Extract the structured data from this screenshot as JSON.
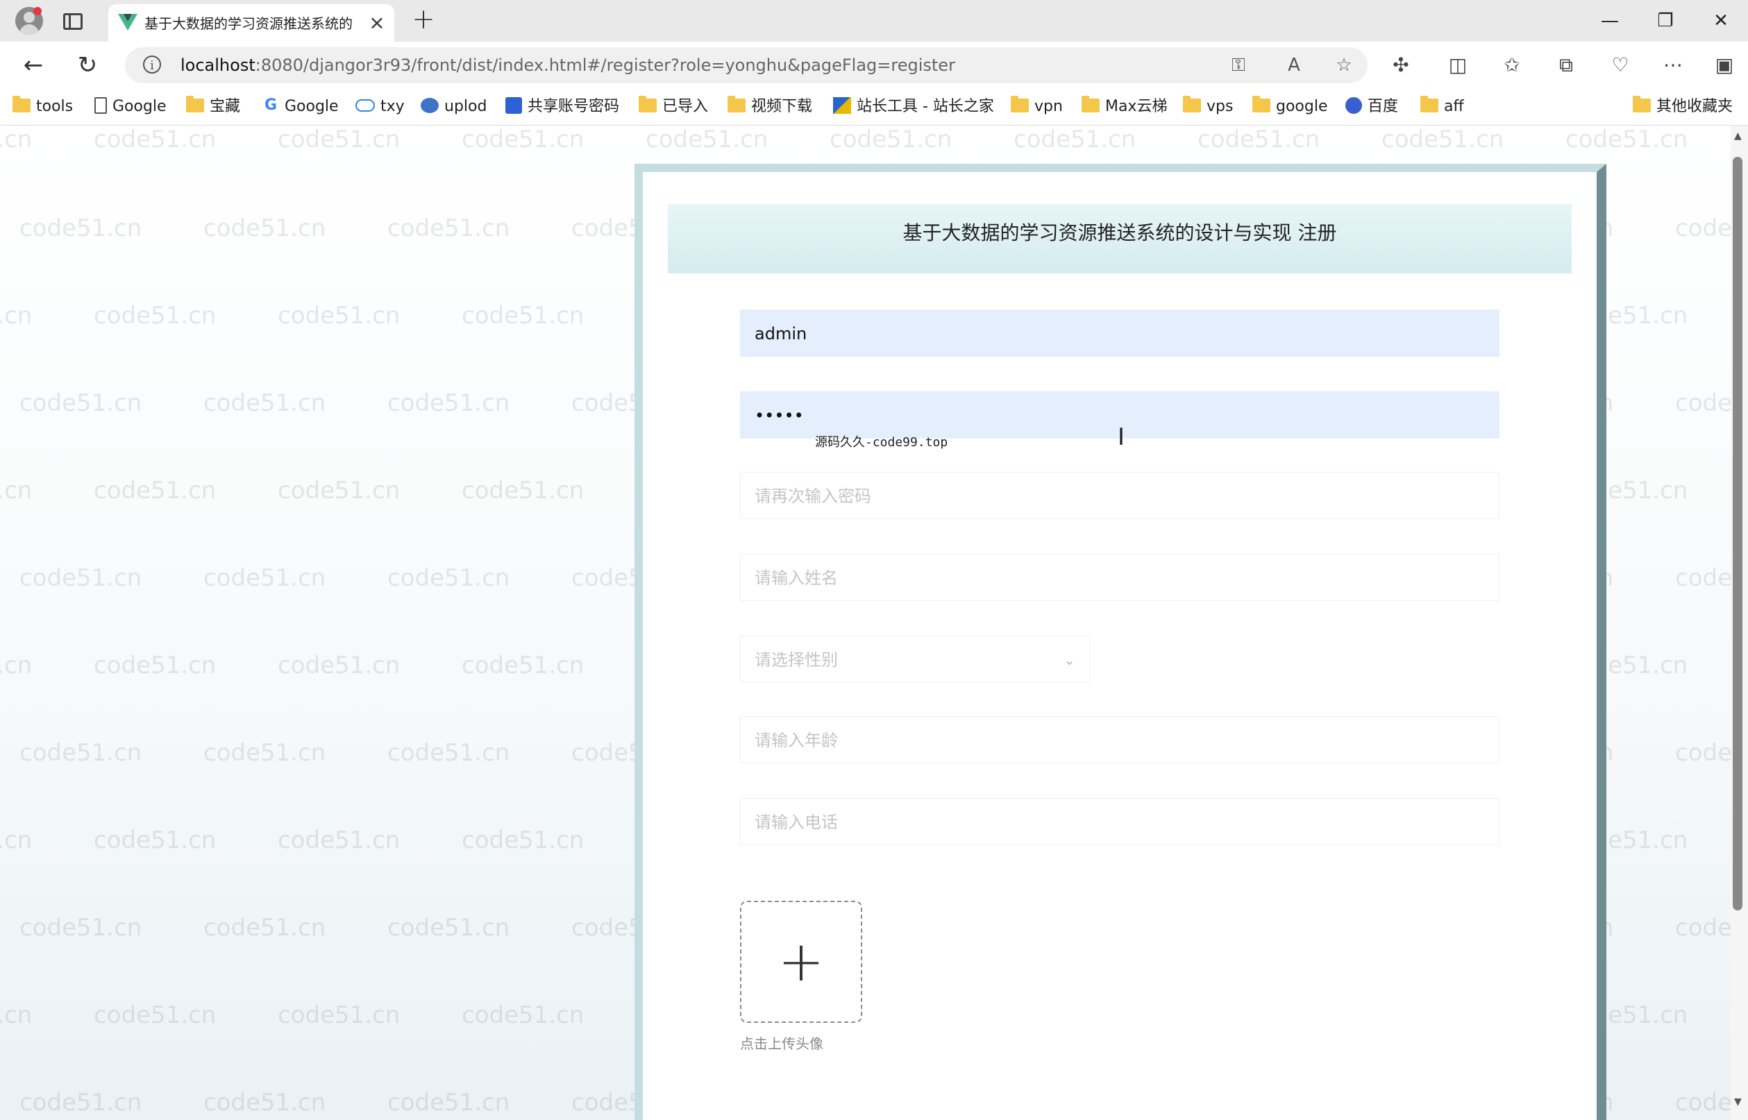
{
  "browser": {
    "tab_title": "基于大数据的学习资源推送系统的设计与实现",
    "url_host": "localhost",
    "url_rest": ":8080/djangor3r93/front/dist/index.html#/register?role=yonghu&pageFlag=register",
    "window_controls": {
      "minimize": "—",
      "restore": "❐",
      "close": "✕"
    }
  },
  "bookmarks": {
    "items": [
      {
        "label": "tools",
        "icon": "folder-icon"
      },
      {
        "label": "Google",
        "icon": "page-icon"
      },
      {
        "label": "宝藏",
        "icon": "folder-icon"
      },
      {
        "label": "Google",
        "icon": "google-icon"
      },
      {
        "label": "txy",
        "icon": "cloud-icon"
      },
      {
        "label": "uplod",
        "icon": "swirl-icon"
      },
      {
        "label": "共享账号密码",
        "icon": "app-icon"
      },
      {
        "label": "已导入",
        "icon": "folder-icon"
      },
      {
        "label": "视频下载",
        "icon": "folder-icon"
      },
      {
        "label": "站长工具 - 站长之家",
        "icon": "image-icon"
      },
      {
        "label": "vpn",
        "icon": "folder-icon"
      },
      {
        "label": "Max云梯",
        "icon": "folder-icon"
      },
      {
        "label": "vps",
        "icon": "folder-icon"
      },
      {
        "label": "google",
        "icon": "folder-icon"
      },
      {
        "label": "百度",
        "icon": "baidu-icon"
      },
      {
        "label": "aff",
        "icon": "folder-icon"
      }
    ],
    "other": "其他收藏夹"
  },
  "watermark": "code51.cn",
  "form": {
    "title": "基于大数据的学习资源推送系统的设计与实现 注册",
    "username_value": "admin",
    "password_value": "•••••",
    "confirm_password_placeholder": "请再次输入密码",
    "name_placeholder": "请输入姓名",
    "gender_placeholder": "请选择性别",
    "age_placeholder": "请输入年龄",
    "phone_placeholder": "请输入电话",
    "upload_label": "点击上传头像"
  },
  "overlay_text": "源码久久-code99.top",
  "colors": {
    "accent": "#c4dde1",
    "border_dark": "#6f8c90",
    "input_filled": "#e5eefc"
  }
}
